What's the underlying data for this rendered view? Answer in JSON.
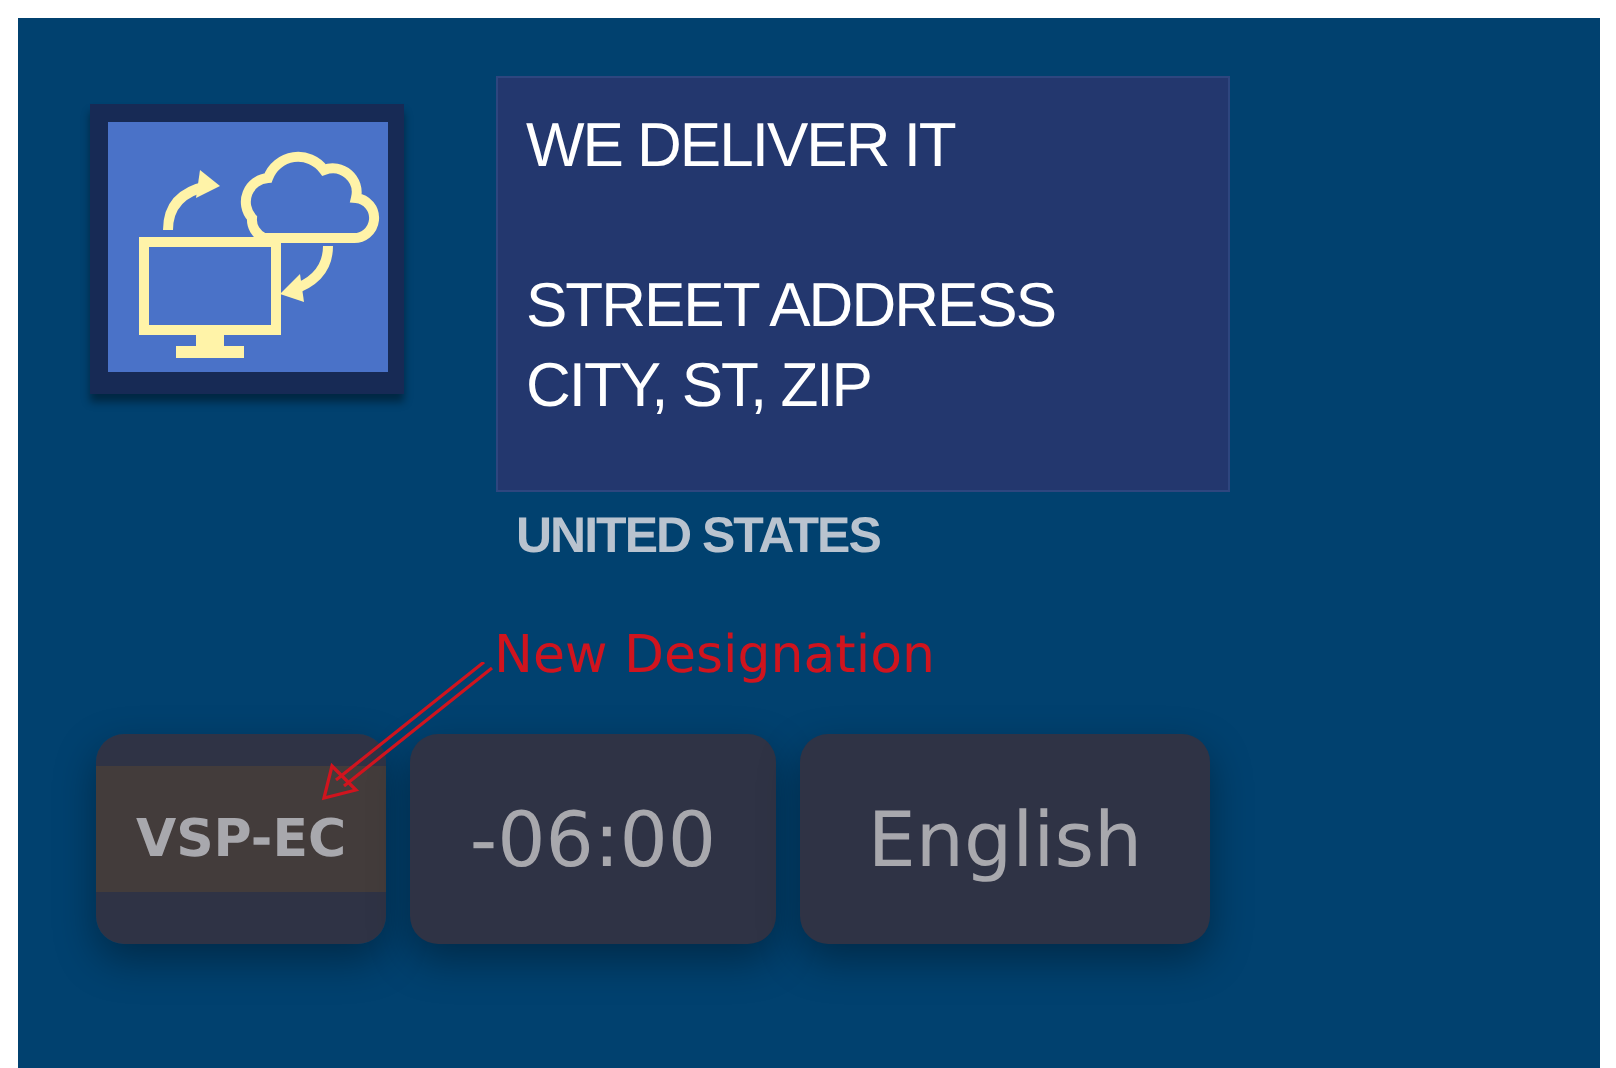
{
  "company": {
    "name": "WE DELIVER IT",
    "street": "STREET ADDRESS",
    "city_line": "CITY, ST, ZIP",
    "country": "UNITED STATES"
  },
  "annotation": {
    "text": "New Designation"
  },
  "chips": [
    {
      "label": "VSP-EC",
      "highlighted": true
    },
    {
      "label": "-06:00",
      "highlighted": false
    },
    {
      "label": "English",
      "highlighted": false
    }
  ]
}
